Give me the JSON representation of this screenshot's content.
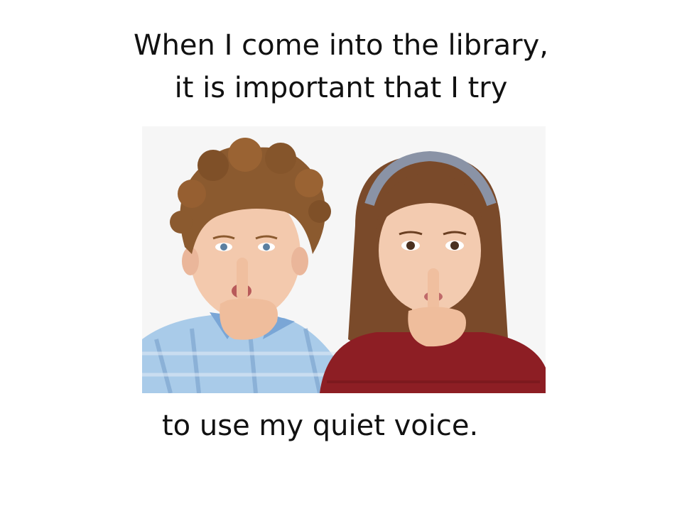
{
  "slide": {
    "title_lines": [
      "When I come into the library,",
      "it is important that I try"
    ],
    "caption": "to use my quiet voice.",
    "photo": {
      "icon": "children-shushing-photo",
      "colors": {
        "boy_hair": "#8a5a2e",
        "girl_hair": "#7a4a2a",
        "skin": "#f2c6a8",
        "boy_shirt": "#9cc3e6",
        "girl_sweater": "#8a1c22",
        "headband": "#8a93a6"
      }
    }
  }
}
